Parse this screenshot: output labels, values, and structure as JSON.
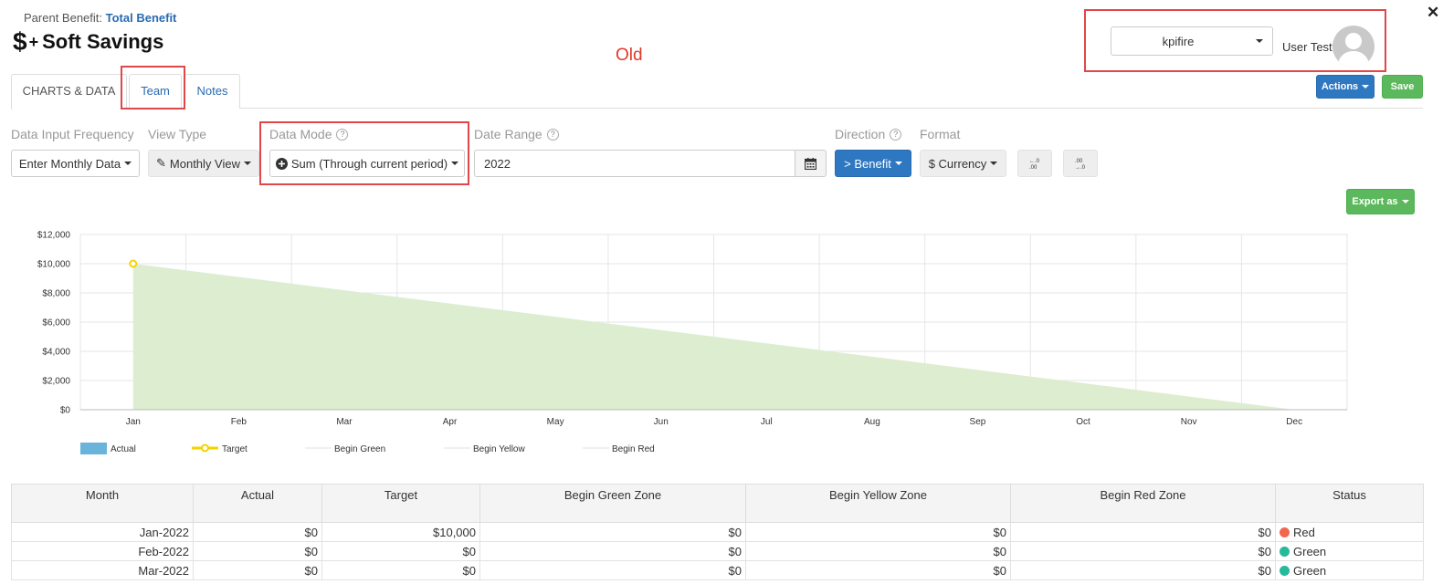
{
  "header": {
    "parent_label": "Parent Benefit:",
    "parent_link": "Total Benefit",
    "title_prefix_icon": "dollar-plus-icon",
    "title": "Soft Savings",
    "old_label": "Old"
  },
  "user": {
    "org_select": "kpifire",
    "name": "User Test"
  },
  "tabs": [
    {
      "label": "CHARTS & DATA",
      "active": true
    },
    {
      "label": "Team",
      "active": false
    },
    {
      "label": "Notes",
      "active": false
    }
  ],
  "actions": {
    "actions_label": "Actions",
    "save_label": "Save",
    "export_label": "Export as"
  },
  "controls": {
    "frequency_label": "Data Input Frequency",
    "frequency_value": "Enter Monthly Data",
    "view_type_label": "View Type",
    "view_type_value": "Monthly View",
    "data_mode_label": "Data Mode",
    "data_mode_value": "Sum (Through current period)",
    "date_range_label": "Date Range",
    "date_range_value": "2022",
    "direction_label": "Direction",
    "direction_value": "> Benefit",
    "format_label": "Format",
    "format_value": "$ Currency"
  },
  "chart_data": {
    "type": "area",
    "categories": [
      "Jan",
      "Feb",
      "Mar",
      "Apr",
      "May",
      "Jun",
      "Jul",
      "Aug",
      "Sep",
      "Oct",
      "Nov",
      "Dec"
    ],
    "y_ticks": [
      "$0",
      "$2,000",
      "$4,000",
      "$6,000",
      "$8,000",
      "$10,000",
      "$12,000"
    ],
    "ylim": [
      0,
      12000
    ],
    "grid": true,
    "series": [
      {
        "name": "Actual",
        "values": [
          10000,
          9090.9,
          8181.8,
          7272.7,
          6363.6,
          5454.5,
          4545.5,
          3636.4,
          2727.3,
          1818.2,
          909.1,
          0
        ],
        "color": "#dcedd0"
      },
      {
        "name": "Target",
        "values": [
          10000,
          null,
          null,
          null,
          null,
          null,
          null,
          null,
          null,
          null,
          null,
          null
        ],
        "color": "#f5d300"
      },
      {
        "name": "Begin Green",
        "values": [],
        "color": "#e0e0e0"
      },
      {
        "name": "Begin Yellow",
        "values": [],
        "color": "#e0e0e0"
      },
      {
        "name": "Begin Red",
        "values": [],
        "color": "#e0e0e0"
      }
    ],
    "legend": {
      "placement": "bottom-left",
      "items": [
        "Actual",
        "Target",
        "Begin Green",
        "Begin Yellow",
        "Begin Red"
      ]
    },
    "actual_legend_color": "#6ab4dc"
  },
  "table": {
    "columns": [
      "Month",
      "Actual",
      "Target",
      "Begin Green Zone",
      "Begin Yellow Zone",
      "Begin Red Zone",
      "Status"
    ],
    "rows": [
      [
        "Jan-2022",
        "$0",
        "$10,000",
        "$0",
        "$0",
        "$0",
        "Red"
      ],
      [
        "Feb-2022",
        "$0",
        "$0",
        "$0",
        "$0",
        "$0",
        "Green"
      ],
      [
        "Mar-2022",
        "$0",
        "$0",
        "$0",
        "$0",
        "$0",
        "Green"
      ]
    ],
    "status_colors": {
      "Red": "#f0694f",
      "Green": "#26b99a"
    }
  }
}
